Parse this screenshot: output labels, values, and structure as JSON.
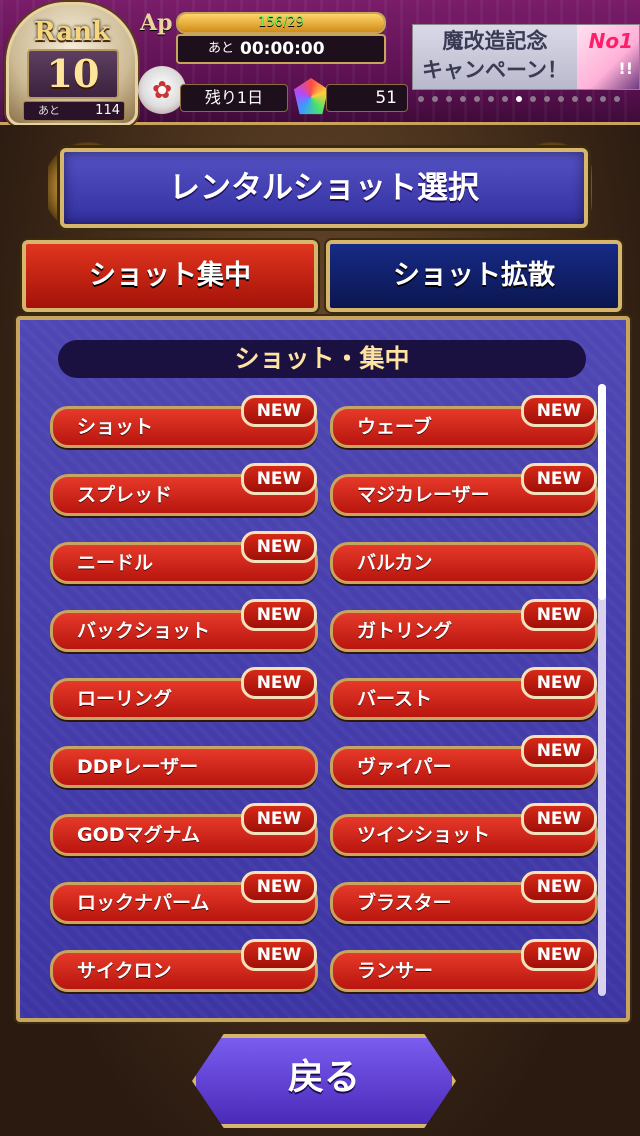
{
  "status": {
    "rank_label": "Rank",
    "rank_value": "10",
    "rank_next_label": "あと",
    "rank_next_value": "114",
    "ap_label": "Ap",
    "ap_value": "156/29",
    "ap_timer_label": "あと",
    "ap_timer": "00:00:00",
    "days_left": "残り1日",
    "gem_count": "51"
  },
  "campaign": {
    "line1": "魔改造記念",
    "line2": "キャンペーン！",
    "badge": "No1",
    "sub": "!!"
  },
  "title": "レンタルショット選択",
  "tabs": [
    {
      "label": "ショット集中",
      "active": true
    },
    {
      "label": "ショット拡散",
      "active": false
    }
  ],
  "section_title": "ショット・集中",
  "new_label": "NEW",
  "items": [
    {
      "label": "ショット",
      "new": true
    },
    {
      "label": "ウェーブ",
      "new": true
    },
    {
      "label": "スプレッド",
      "new": true
    },
    {
      "label": "マジカレーザー",
      "new": true
    },
    {
      "label": "ニードル",
      "new": true
    },
    {
      "label": "バルカン",
      "new": false
    },
    {
      "label": "バックショット",
      "new": true
    },
    {
      "label": "ガトリング",
      "new": true
    },
    {
      "label": "ローリング",
      "new": true
    },
    {
      "label": "バースト",
      "new": true
    },
    {
      "label": "DDPレーザー",
      "new": false
    },
    {
      "label": "ヴァイパー",
      "new": true
    },
    {
      "label": "GODマグナム",
      "new": true
    },
    {
      "label": "ツインショット",
      "new": true
    },
    {
      "label": "ロックナパーム",
      "new": true
    },
    {
      "label": "ブラスター",
      "new": true
    },
    {
      "label": "サイクロン",
      "new": true
    },
    {
      "label": "ランサー",
      "new": true
    }
  ],
  "back_label": "戻る",
  "colors": {
    "accent_gold": "#d6b56c",
    "item_red": "#d62a18",
    "panel_blue": "#4f47b4"
  }
}
